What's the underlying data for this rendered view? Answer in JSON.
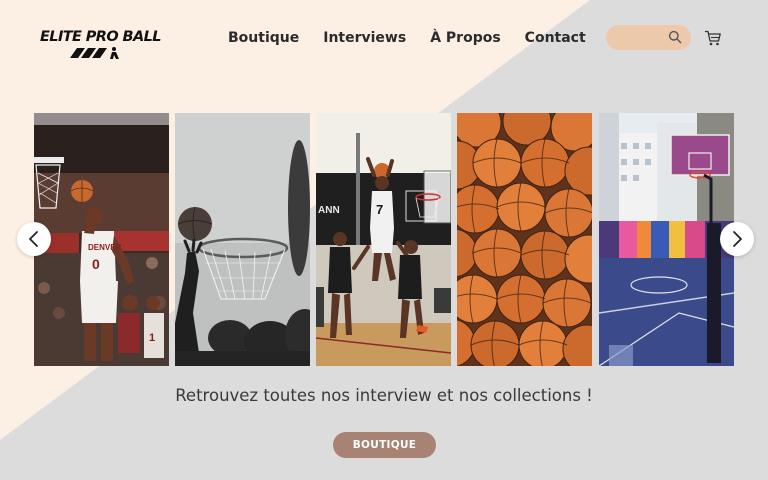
{
  "brand": {
    "name": "ELITE PRO BALL"
  },
  "nav": {
    "items": [
      {
        "label": "Boutique"
      },
      {
        "label": "Interviews"
      },
      {
        "label": "À Propos"
      },
      {
        "label": "Contact"
      }
    ]
  },
  "search": {
    "placeholder": "",
    "icon": "search-icon"
  },
  "cart": {
    "icon": "cart-icon"
  },
  "carousel": {
    "prev_icon": "chevron-left-icon",
    "next_icon": "chevron-right-icon",
    "photos": [
      {
        "subject": "player dunking in red jersey",
        "jersey_text": "DENVER",
        "jersey_number": "0"
      },
      {
        "subject": "ball going into hoop"
      },
      {
        "subject": "player dunking in white jersey",
        "jersey_number": "7"
      },
      {
        "subject": "pile of orange basketballs"
      },
      {
        "subject": "colorful outdoor court"
      }
    ]
  },
  "tagline": "Retrouvez toutes nos interview et nos collections !",
  "cta": {
    "label": "BOUTIQUE"
  },
  "colors": {
    "cream": "#fcefe3",
    "grey": "#dcdcdc",
    "search_bg": "#ecc9ab",
    "button": "#a88272",
    "ball": "#d9722e"
  }
}
